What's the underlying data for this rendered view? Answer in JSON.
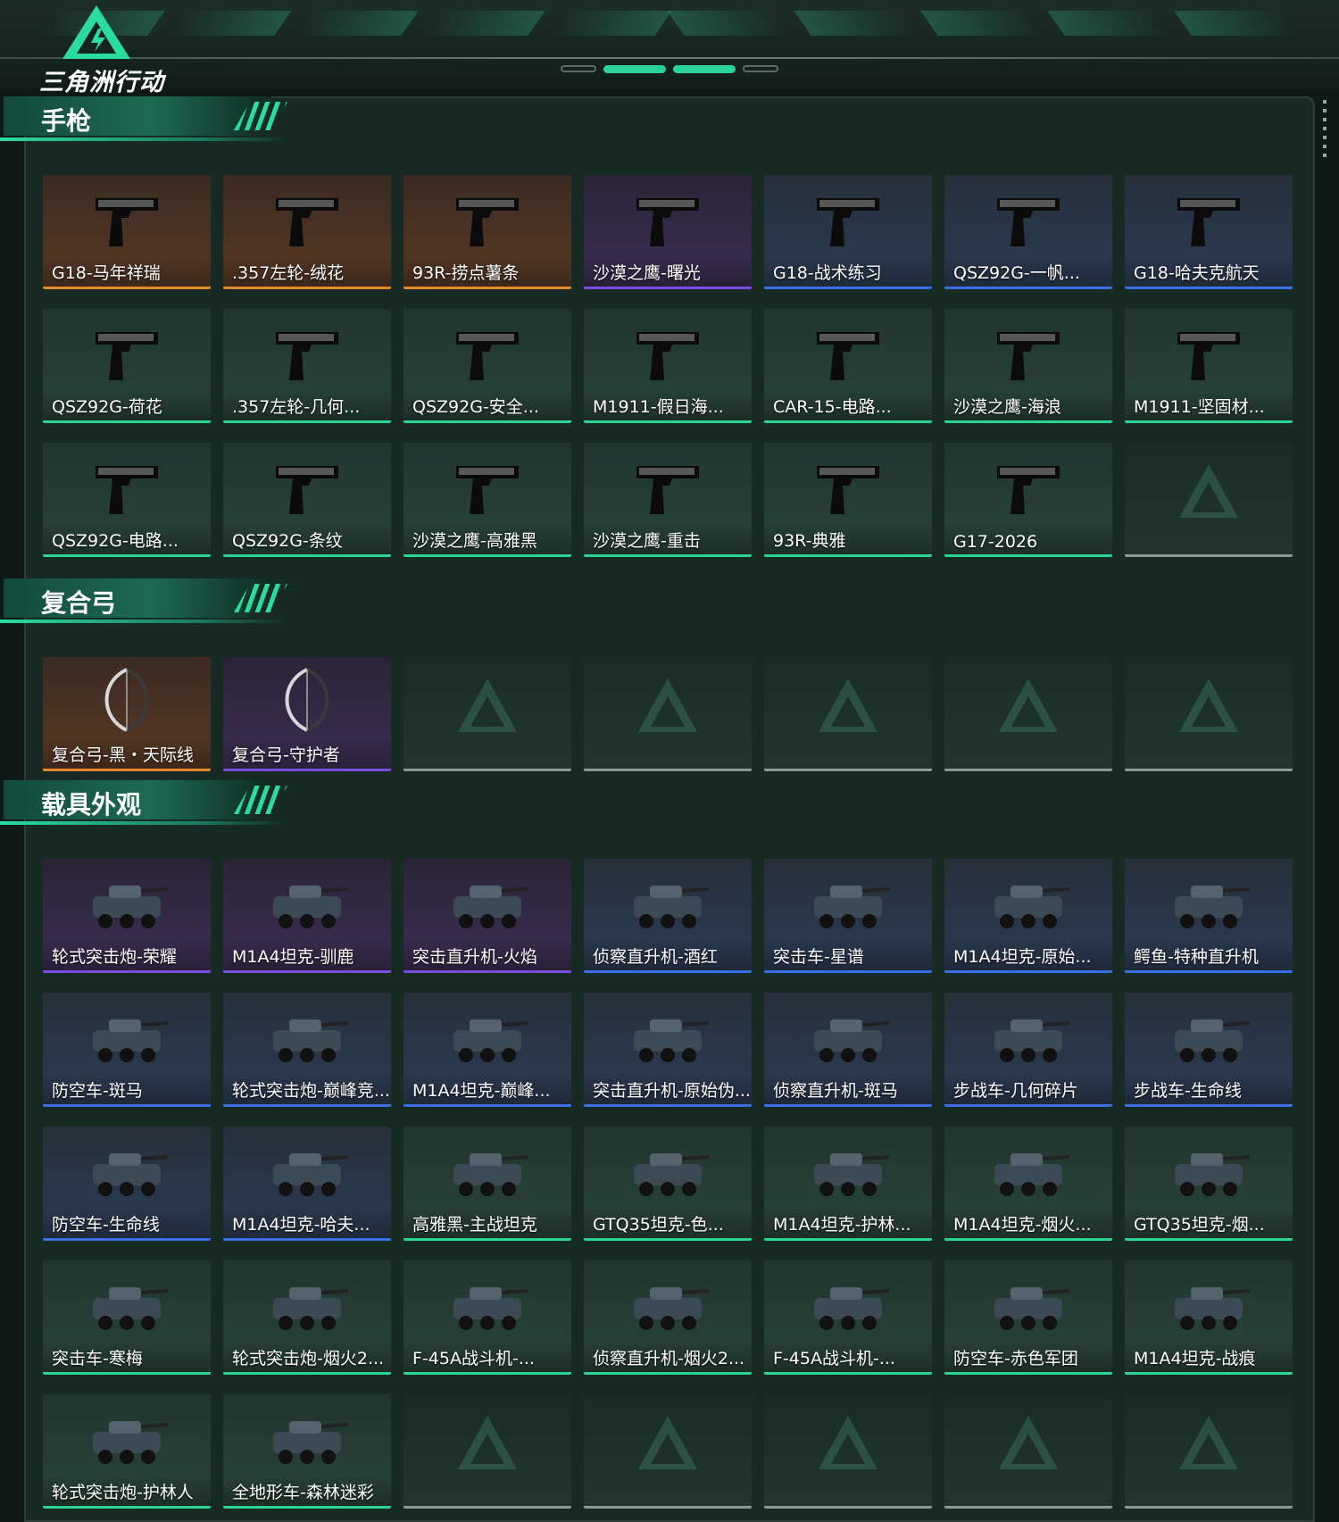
{
  "app": {
    "logo_text": "三角洲行动",
    "accent_color": "#2cdc9e"
  },
  "rarity_colors": {
    "gold": "#e58a2c",
    "purple": "#7a4fe0",
    "blue": "#3a6fe6",
    "green": "#2cd491",
    "empty": "#8a9a95"
  },
  "sections": [
    {
      "title": "手枪",
      "icon": "pistol-icon",
      "items": [
        {
          "name": "G18-马年祥瑞",
          "rarity": "gold"
        },
        {
          "name": ".357左轮-绒花",
          "rarity": "gold"
        },
        {
          "name": "93R-捞点薯条",
          "rarity": "gold"
        },
        {
          "name": "沙漠之鹰-曙光",
          "rarity": "purple"
        },
        {
          "name": "G18-战术练习",
          "rarity": "blue"
        },
        {
          "name": "QSZ92G-一帆...",
          "rarity": "blue"
        },
        {
          "name": "G18-哈夫克航天",
          "rarity": "blue"
        },
        {
          "name": "QSZ92G-荷花",
          "rarity": "green"
        },
        {
          "name": ".357左轮-几何...",
          "rarity": "green"
        },
        {
          "name": "QSZ92G-安全...",
          "rarity": "green"
        },
        {
          "name": "M1911-假日海...",
          "rarity": "green"
        },
        {
          "name": "CAR-15-电路...",
          "rarity": "green"
        },
        {
          "name": "沙漠之鹰-海浪",
          "rarity": "green"
        },
        {
          "name": "M1911-坚固材...",
          "rarity": "green"
        },
        {
          "name": "QSZ92G-电路...",
          "rarity": "green"
        },
        {
          "name": "QSZ92G-条纹",
          "rarity": "green"
        },
        {
          "name": "沙漠之鹰-高雅黑",
          "rarity": "green"
        },
        {
          "name": "沙漠之鹰-重击",
          "rarity": "green"
        },
        {
          "name": "93R-典雅",
          "rarity": "green"
        },
        {
          "name": "G17-2026",
          "rarity": "green"
        },
        {
          "name": "",
          "rarity": "empty"
        }
      ]
    },
    {
      "title": "复合弓",
      "icon": "bow-icon",
      "items": [
        {
          "name": "复合弓-黑・天际线",
          "rarity": "gold"
        },
        {
          "name": "复合弓-守护者",
          "rarity": "purple"
        },
        {
          "name": "",
          "rarity": "empty"
        },
        {
          "name": "",
          "rarity": "empty"
        },
        {
          "name": "",
          "rarity": "empty"
        },
        {
          "name": "",
          "rarity": "empty"
        },
        {
          "name": "",
          "rarity": "empty"
        }
      ]
    },
    {
      "title": "载具外观",
      "icon": "vehicle-icon",
      "items": [
        {
          "name": "轮式突击炮-荣耀",
          "rarity": "purple"
        },
        {
          "name": "M1A4坦克-驯鹿",
          "rarity": "purple"
        },
        {
          "name": "突击直升机-火焰",
          "rarity": "purple"
        },
        {
          "name": "侦察直升机-酒红",
          "rarity": "blue"
        },
        {
          "name": "突击车-星谱",
          "rarity": "blue"
        },
        {
          "name": "M1A4坦克-原始...",
          "rarity": "blue"
        },
        {
          "name": "鳄鱼-特种直升机",
          "rarity": "blue"
        },
        {
          "name": "防空车-斑马",
          "rarity": "blue"
        },
        {
          "name": "轮式突击炮-巅峰竞...",
          "rarity": "blue"
        },
        {
          "name": "M1A4坦克-巅峰...",
          "rarity": "blue"
        },
        {
          "name": "突击直升机-原始伪...",
          "rarity": "blue"
        },
        {
          "name": "侦察直升机-斑马",
          "rarity": "blue"
        },
        {
          "name": "步战车-几何碎片",
          "rarity": "blue"
        },
        {
          "name": "步战车-生命线",
          "rarity": "blue"
        },
        {
          "name": "防空车-生命线",
          "rarity": "blue"
        },
        {
          "name": "M1A4坦克-哈夫...",
          "rarity": "blue"
        },
        {
          "name": "高雅黑-主战坦克",
          "rarity": "green"
        },
        {
          "name": "GTQ35坦克-色...",
          "rarity": "green"
        },
        {
          "name": "M1A4坦克-护林...",
          "rarity": "green"
        },
        {
          "name": "M1A4坦克-烟火...",
          "rarity": "green"
        },
        {
          "name": "GTQ35坦克-烟...",
          "rarity": "green"
        },
        {
          "name": "突击车-寒梅",
          "rarity": "green"
        },
        {
          "name": "轮式突击炮-烟火2...",
          "rarity": "green"
        },
        {
          "name": "F-45A战斗机-...",
          "rarity": "green"
        },
        {
          "name": "侦察直升机-烟火2...",
          "rarity": "green"
        },
        {
          "name": "F-45A战斗机-...",
          "rarity": "green"
        },
        {
          "name": "防空车-赤色军团",
          "rarity": "green"
        },
        {
          "name": "M1A4坦克-战痕",
          "rarity": "green"
        },
        {
          "name": "轮式突击炮-护林人",
          "rarity": "green"
        },
        {
          "name": "全地形车-森林迷彩",
          "rarity": "green"
        },
        {
          "name": "",
          "rarity": "empty"
        },
        {
          "name": "",
          "rarity": "empty"
        },
        {
          "name": "",
          "rarity": "empty"
        },
        {
          "name": "",
          "rarity": "empty"
        },
        {
          "name": "",
          "rarity": "empty"
        }
      ]
    }
  ]
}
